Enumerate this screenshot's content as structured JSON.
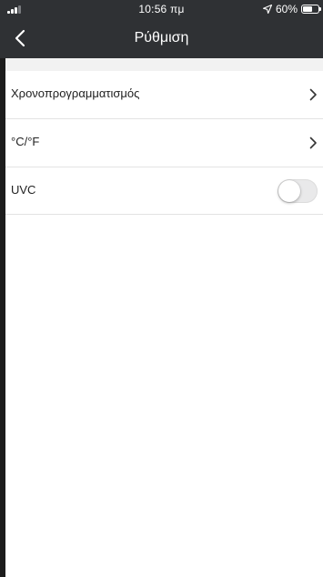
{
  "status_bar": {
    "time": "10:56 πμ",
    "battery_text": "60%",
    "battery_level": 0.6
  },
  "nav": {
    "title": "Ρύθμιση",
    "back_icon": "chevron-left-icon"
  },
  "settings": {
    "items": [
      {
        "label": "Χρονοπρογραμματισμός",
        "control": "chevron-right-icon"
      },
      {
        "label": "°C/°F",
        "control": "chevron-right-icon"
      },
      {
        "label": "UVC",
        "control": "toggle",
        "enabled": false
      }
    ]
  },
  "colors": {
    "header_bg": "#2f3134",
    "page_bg": "#ffffff"
  }
}
